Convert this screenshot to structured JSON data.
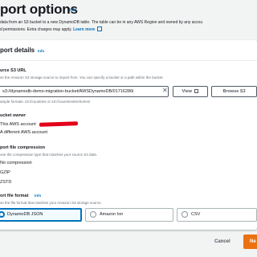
{
  "header": {
    "title": "port options",
    "info_label": "Info",
    "description_line1": "data from an S3 bucket to a new DynamoDB table. The table can be in any AWS Region and owned by any accou",
    "description_line2": "d permissions. Extra charges may apply.",
    "learn_more": "Learn more"
  },
  "card": {
    "title": "port details",
    "info_label": "Info"
  },
  "source_url": {
    "label": "urce S3 URL",
    "hint": "se the Amazon S3 storage source to import from. You can specify a bucket or a path within the bucket.",
    "value": "s3://dynamodb-demo-migration-bucket/AWSDynamoDB/01716286i",
    "example": "ample formats: s3://countries or s3://countries/territories/",
    "view_button": "View",
    "browse_button": "Browse S3"
  },
  "bucket_owner": {
    "label": "ucket owner",
    "options": [
      "This AWS account",
      "A different AWS account"
    ]
  },
  "compression": {
    "label": "port file compression",
    "hint": "ose the compression type that matches your source S3 data.",
    "options": [
      "No compression",
      "GZIP",
      "ZSTD"
    ]
  },
  "file_format": {
    "label": "ort file format",
    "info_label": "Info",
    "hint": "se the file format that matches your Amazon S3 storage source.",
    "options": [
      "DynamoDB JSON",
      "Amazon Ion",
      "CSV"
    ],
    "selected": "DynamoDB JSON"
  },
  "footer": {
    "cancel": "Cancel",
    "next": "Ne"
  },
  "colors": {
    "accent": "#0073bb",
    "primary_button": "#ec7211",
    "redaction": "#e3001b"
  }
}
